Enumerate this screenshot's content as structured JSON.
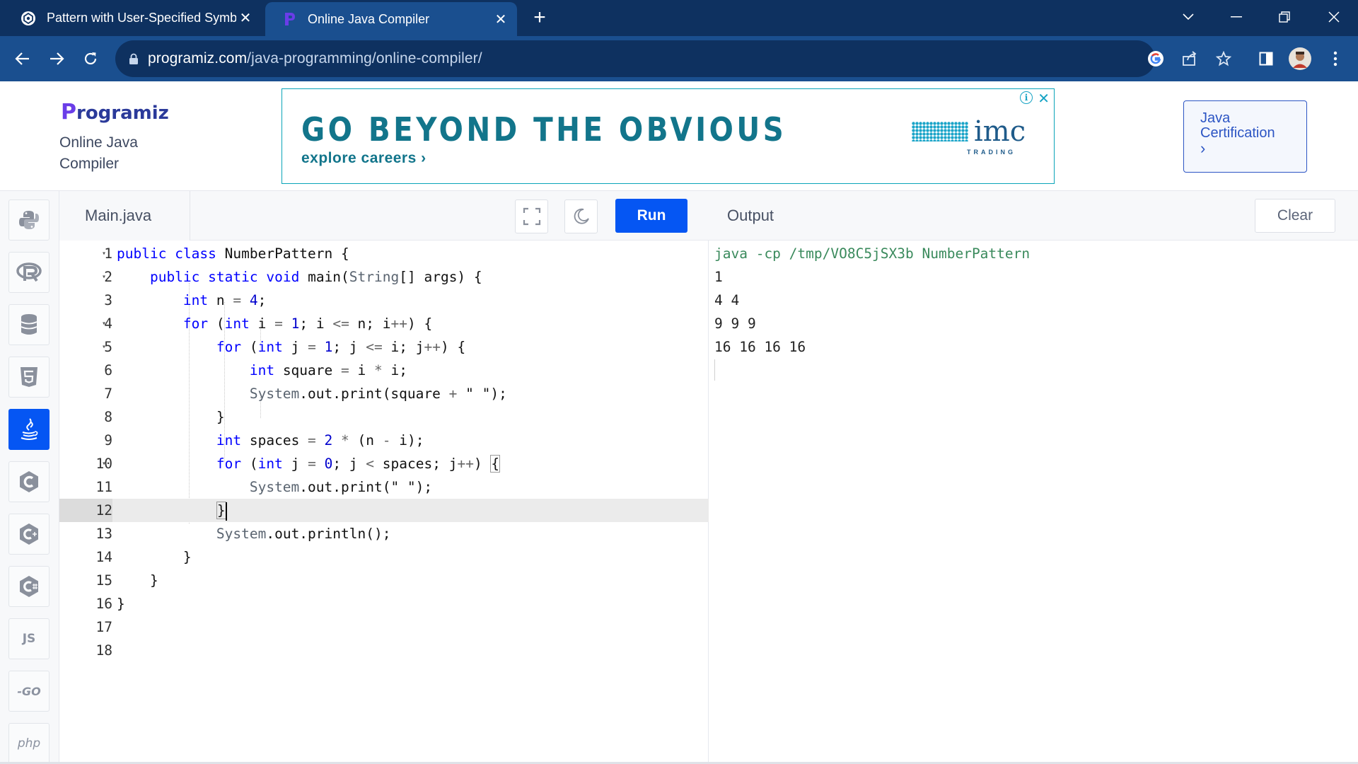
{
  "browser": {
    "tabs": [
      {
        "title": "Pattern with User-Specified Symb",
        "active": false,
        "icon": "chatgpt-icon"
      },
      {
        "title": "Online Java Compiler",
        "active": true,
        "icon": "programiz-icon"
      }
    ],
    "url_domain": "programiz.com",
    "url_path": "/java-programming/online-compiler/"
  },
  "header": {
    "logo": "rogramiz",
    "logo_initial": "P",
    "subtitle": "Online Java Compiler",
    "cert_button": "Java Certification",
    "cert_chevron": "›"
  },
  "ad": {
    "headline": "GO BEYOND THE OBVIOUS",
    "subline": "explore careers ›",
    "brand": "imc",
    "brand_sub": "TRADING"
  },
  "sidebar": {
    "languages": [
      {
        "name": "python",
        "icon": "python-icon"
      },
      {
        "name": "r",
        "icon": "r-icon"
      },
      {
        "name": "sql",
        "icon": "database-icon"
      },
      {
        "name": "html",
        "icon": "html5-icon"
      },
      {
        "name": "java",
        "icon": "java-icon",
        "active": true
      },
      {
        "name": "c",
        "icon": "c-icon"
      },
      {
        "name": "cpp",
        "icon": "cpp-icon"
      },
      {
        "name": "csharp",
        "icon": "csharp-icon"
      },
      {
        "name": "js",
        "label": "JS"
      },
      {
        "name": "go",
        "label": "-GO"
      },
      {
        "name": "php",
        "label": "php"
      }
    ]
  },
  "editor": {
    "filename": "Main.java",
    "run_label": "Run",
    "active_line": 12,
    "line_numbers": [
      "1",
      "2",
      "3",
      "4",
      "5",
      "6",
      "7",
      "8",
      "9",
      "10",
      "11",
      "12",
      "13",
      "14",
      "15",
      "16",
      "17",
      "18"
    ],
    "lines": [
      "public class NumberPattern {",
      "    public static void main(String[] args) {",
      "        int n = 4;",
      "        for (int i = 1; i <= n; i++) {",
      "            for (int j = 1; j <= i; j++) {",
      "                int square = i * i;",
      "                System.out.print(square + \" \");",
      "            }",
      "            int spaces = 2 * (n - i);",
      "            for (int j = 0; j < spaces; j++) {",
      "                System.out.print(\" \");",
      "            }",
      "            System.out.println();",
      "        }",
      "    }",
      "}",
      "",
      ""
    ]
  },
  "output": {
    "title": "Output",
    "clear_label": "Clear",
    "command": "java -cp /tmp/VO8C5jSX3b NumberPattern",
    "lines": [
      "1",
      "4 4",
      "9 9 9",
      "16 16 16 16"
    ]
  }
}
